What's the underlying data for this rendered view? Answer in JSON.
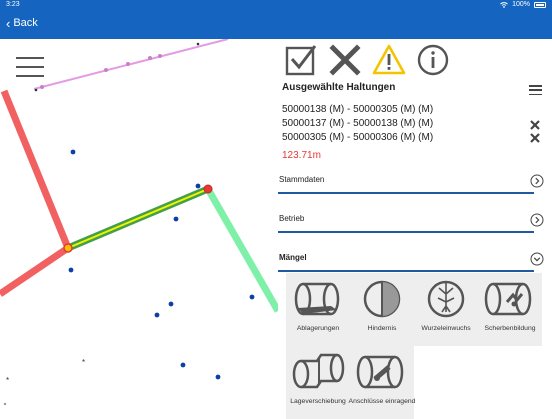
{
  "status_bar": {
    "time": "3:23",
    "battery": "100%"
  },
  "nav": {
    "back_label": "Back"
  },
  "panel": {
    "title": "Ausgewählte Haltungen",
    "selected": [
      "50000138 (M) - 50000305 (M) (M)",
      "50000137 (M) - 50000138 (M) (M)",
      "50000305 (M) - 50000306 (M) (M)"
    ],
    "total_length": "123.71m",
    "sections": [
      {
        "label": "Stammdaten",
        "expanded": false
      },
      {
        "label": "Betrieb",
        "expanded": false
      },
      {
        "label": "Mängel",
        "expanded": true
      }
    ],
    "defects": [
      {
        "label": "Ablagerungen",
        "icon": "deposit-icon"
      },
      {
        "label": "Hindernis",
        "icon": "obstacle-icon"
      },
      {
        "label": "Wurzeleinwuchs",
        "icon": "root-intrusion-icon"
      },
      {
        "label": "Scherbenbildung",
        "icon": "fracture-icon"
      },
      {
        "label": "Lageverschiebung",
        "icon": "displacement-icon"
      },
      {
        "label": "Anschlüsse einragend",
        "icon": "protruding-connection-icon"
      }
    ]
  },
  "colors": {
    "brand": "#1565c0",
    "accent_line": "#1f5aa0",
    "warning": "#f5c400",
    "length_text": "#e53935",
    "pipe_red": "#f05050",
    "pipe_selected_green": "#43a047",
    "pipe_selected_yellow": "#f2f200",
    "pipe_light_green": "#7ef0a8",
    "pipe_pink": "#e39be3",
    "node_blue": "#0d3fa8"
  }
}
